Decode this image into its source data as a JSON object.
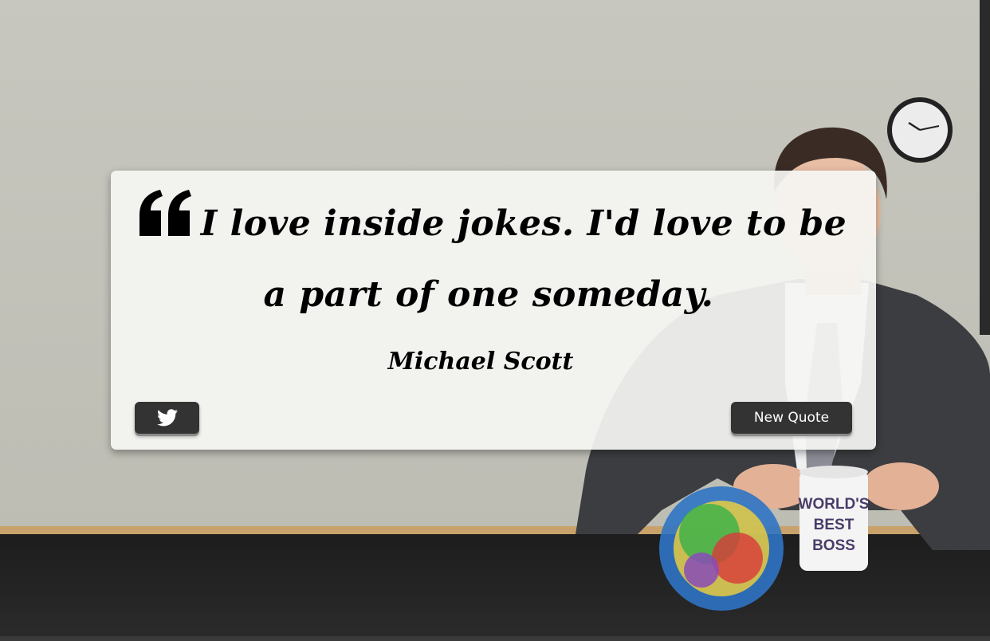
{
  "quote": {
    "line1": "I love inside jokes. I'd love to be",
    "line2": "a part of one someday.",
    "author": "Michael Scott"
  },
  "buttons": {
    "tweet_icon": "twitter-icon",
    "new_quote_label": "New Quote"
  },
  "background": {
    "mug_text": [
      "WORLD'S",
      "BEST",
      "BOSS"
    ]
  },
  "colors": {
    "button_bg": "#333333",
    "card_bg": "#f4f4f2",
    "wall": "#c4c4bc"
  }
}
